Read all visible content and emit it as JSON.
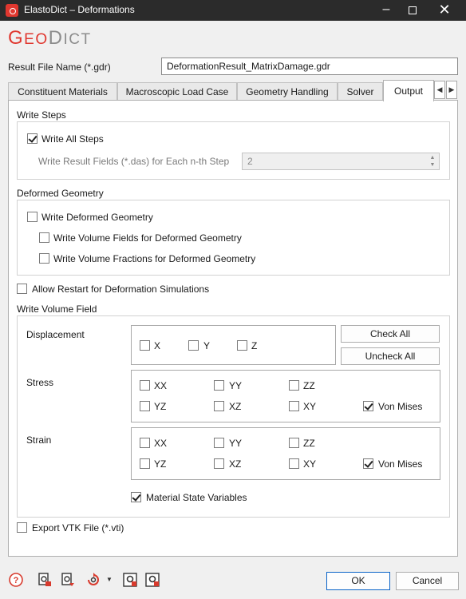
{
  "window": {
    "title": "ElastoDict – Deformations"
  },
  "logo": {
    "a": "G",
    "b": "EO",
    "c": "D",
    "d": "ICT"
  },
  "result_file": {
    "label": "Result File Name (*.gdr)",
    "value": "DeformationResult_MatrixDamage.gdr"
  },
  "tabs": [
    "Constituent Materials",
    "Macroscopic Load Case",
    "Geometry Handling",
    "Solver",
    "Output"
  ],
  "active_tab": "Output",
  "write_steps": {
    "heading": "Write Steps",
    "write_all_label": "Write All Steps",
    "write_all_checked": true,
    "nth_label": "Write Result Fields (*.das) for Each n-th Step",
    "nth_value": "2"
  },
  "deformed_geometry": {
    "heading": "Deformed Geometry",
    "write_deformed_label": "Write Deformed Geometry",
    "volume_fields_label": "Write Volume Fields for Deformed Geometry",
    "volume_fractions_label": "Write Volume Fractions for Deformed Geometry"
  },
  "allow_restart_label": "Allow Restart for Deformation Simulations",
  "write_volume_field": {
    "heading": "Write Volume Field",
    "displacement": {
      "label": "Displacement",
      "x": "X",
      "y": "Y",
      "z": "Z"
    },
    "check_all": "Check All",
    "uncheck_all": "Uncheck All",
    "stress": {
      "label": "Stress",
      "xx": "XX",
      "yy": "YY",
      "zz": "ZZ",
      "yz": "YZ",
      "xz": "XZ",
      "xy": "XY",
      "von_mises": "Von Mises",
      "von_mises_checked": true
    },
    "strain": {
      "label": "Strain",
      "xx": "XX",
      "yy": "YY",
      "zz": "ZZ",
      "yz": "YZ",
      "xz": "XZ",
      "xy": "XY",
      "von_mises": "Von Mises",
      "von_mises_checked": true
    },
    "material_state_label": "Material State Variables",
    "material_state_checked": true
  },
  "export_vtk_label": "Export VTK File (*.vti)",
  "buttons": {
    "ok": "OK",
    "cancel": "Cancel"
  },
  "colors": {
    "brand_red": "#e0372f",
    "titlebar": "#2b2b2b",
    "ok_border": "#0a64c8"
  },
  "bottom_icons": [
    "help-icon",
    "load-settings-icon",
    "save-settings-icon",
    "reset-icon",
    "run-options-icon",
    "run-icon"
  ]
}
